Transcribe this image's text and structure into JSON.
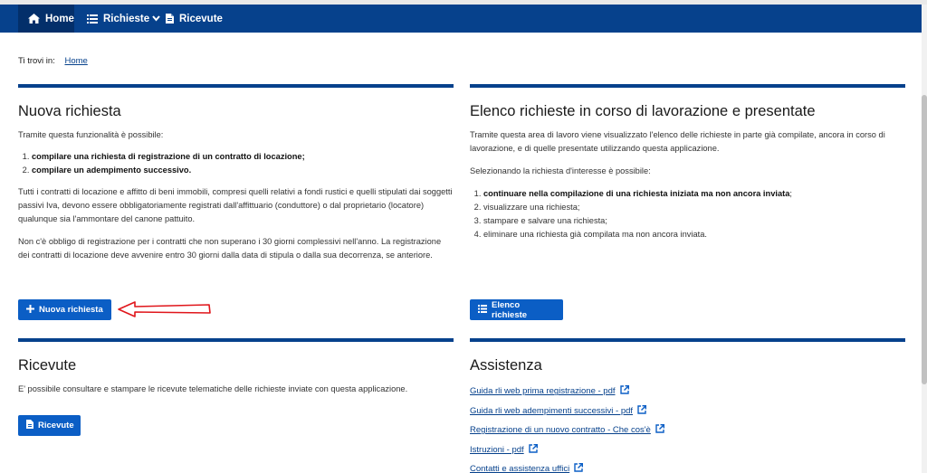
{
  "nav": {
    "home": "Home",
    "richieste": "Richieste",
    "ricevute": "Ricevute"
  },
  "breadcrumb": {
    "prefix": "Ti trovi in:",
    "home": "Home"
  },
  "nuova": {
    "title": "Nuova richiesta",
    "intro": "Tramite questa funzionalità è possibile:",
    "items": [
      "compilare una richiesta di registrazione di un contratto di locazione;",
      "compilare un adempimento successivo."
    ],
    "para1": "Tutti i contratti di locazione e affitto di beni immobili, compresi quelli relativi a fondi rustici e quelli stipulati dai soggetti passivi Iva, devono essere obbligatoriamente registrati dall'affittuario (conduttore) o dal proprietario (locatore) qualunque sia l'ammontare del canone pattuito.",
    "para2": "Non c'è obbligo di registrazione per i contratti che non superano i 30 giorni complessivi nell'anno. La registrazione dei contratti di locazione deve avvenire entro 30 giorni dalla data di stipula o dalla sua decorrenza, se anteriore.",
    "button": "Nuova richiesta"
  },
  "elenco": {
    "title": "Elenco richieste in corso di lavorazione e presentate",
    "intro": "Tramite questa area di lavoro viene visualizzato l'elenco delle richieste in parte già compilate, ancora in corso di lavorazione, e di quelle presentate utilizzando questa applicazione.",
    "intro2": "Selezionando la richiesta d'interesse è possibile:",
    "item1_bold": "continuare nella compilazione di una richiesta iniziata ma non ancora inviata",
    "item1_rest": ";",
    "items": [
      "visualizzare una richiesta;",
      "stampare e salvare una richiesta;",
      "eliminare una richiesta già compilata ma non ancora inviata."
    ],
    "button": "Elenco richieste"
  },
  "ricevute": {
    "title": "Ricevute",
    "text": "E' possibile consultare e stampare le ricevute telematiche delle richieste inviate con questa applicazione.",
    "button": "Ricevute"
  },
  "assistenza": {
    "title": "Assistenza",
    "links": [
      "Guida rli web prima registrazione - pdf",
      "Guida rli web adempimenti successivi - pdf",
      "Registrazione di un nuovo contratto - Che cos'è",
      "Istruzioni - pdf",
      "Contatti e assistenza uffici"
    ]
  },
  "colors": {
    "navbar": "#06418c",
    "button": "#0b5ec5",
    "annotation_arrow": "#e0161b"
  },
  "icons": [
    "home-icon",
    "list-icon",
    "chevron-down-icon",
    "file-icon",
    "plus-icon",
    "external-link-icon",
    "arrow-annotation"
  ]
}
